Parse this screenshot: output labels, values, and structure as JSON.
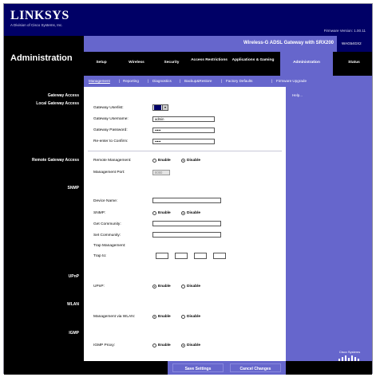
{
  "header": {
    "logo": "LINKSYS",
    "logo_sub": "A Division of Cisco Systems, Inc.",
    "firmware": "Firmware Version: 1.00.11"
  },
  "admin": {
    "title": "Administration",
    "product_name": "Wireless-G ADSL Gateway with SRX200",
    "model": "WAG54GX2"
  },
  "tabs": [
    {
      "label": "Setup"
    },
    {
      "label": "Wireless"
    },
    {
      "label": "Security"
    },
    {
      "label": "Access Restrictions"
    },
    {
      "label": "Applications & Gaming"
    },
    {
      "label": "Administration"
    },
    {
      "label": "Status"
    }
  ],
  "subtabs": [
    {
      "label": "Management"
    },
    {
      "label": "Reporting"
    },
    {
      "label": "Diagnostics"
    },
    {
      "label": "Backup&Restore"
    },
    {
      "label": "Factory Defaults"
    },
    {
      "label": "Firmware Upgrade"
    }
  ],
  "sections": {
    "gateway_access": "Gateway Access",
    "local_gateway_access": "Local Gateway Access",
    "remote_gateway_access": "Remote Gateway Access",
    "snmp": "SNMP",
    "upnp": "UPnP",
    "wlan": "WLAN",
    "igmp": "IGMP"
  },
  "local": {
    "user_list_label": "Gateway Userlist:",
    "user_list_value": "1",
    "username_label": "Gateway Username:",
    "username_value": "admin",
    "password_label": "Gateway Password:",
    "password_value": "•••••",
    "reenter_label": "Re-enter to Confirm:",
    "reenter_value": "•••••"
  },
  "remote": {
    "mgmt_label": "Remote Management:",
    "enable": "Enable",
    "disable": "Disable",
    "selected": "Disable",
    "port_label": "Management Port:",
    "port_value": "8080"
  },
  "snmp": {
    "device_name_label": "Device Name:",
    "snmp_label": "SNMP:",
    "enable": "Enable",
    "disable": "Disable",
    "selected": "Disable",
    "get_label": "Get Community:",
    "set_label": "Set Community:",
    "trap_mgmt_label": "Trap Management:",
    "trap_to_label": "Trap to:"
  },
  "upnp": {
    "label": "UPnP:",
    "enable": "Enable",
    "disable": "Disable",
    "selected": "Enable"
  },
  "wlan": {
    "label": "Management via WLAN:",
    "enable": "Enable",
    "disable": "Disable",
    "selected": "Enable"
  },
  "igmp": {
    "label": "IGMP Proxy:",
    "enable": "Enable",
    "disable": "Disable",
    "selected": "Disable"
  },
  "help": {
    "label": "Help..."
  },
  "footer": {
    "save": "Save Settings",
    "cancel": "Cancel Changes"
  },
  "cisco": {
    "label": "Cisco Systems"
  },
  "colors": {
    "navy": "#000066",
    "purple": "#6666cc",
    "black": "#000000"
  }
}
